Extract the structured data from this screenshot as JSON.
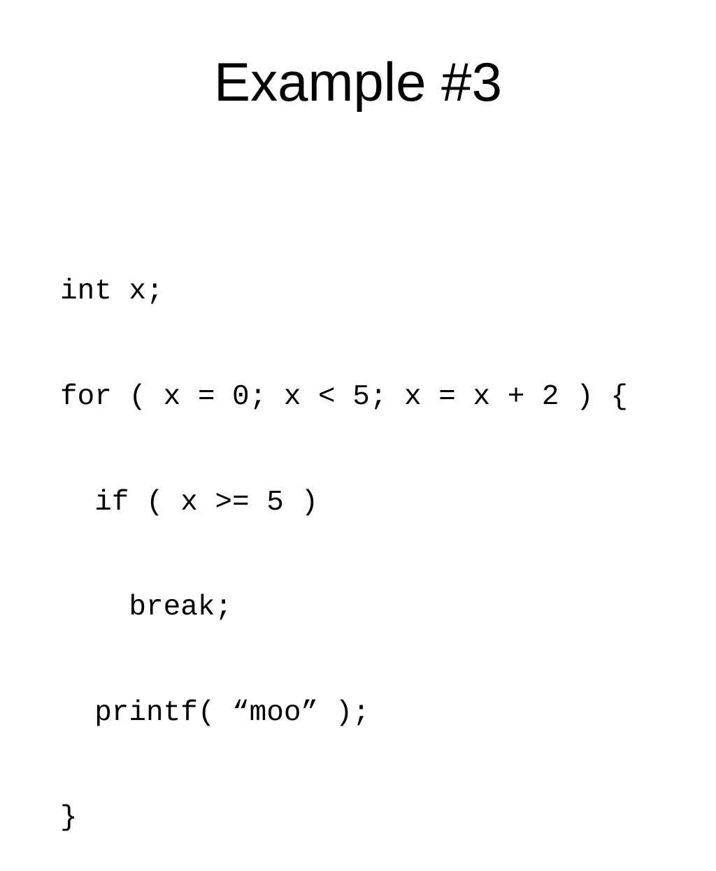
{
  "slide": {
    "title": "Example #3",
    "code_lines": [
      "int x;",
      "for ( x = 0; x < 5; x = x + 2 ) {",
      "  if ( x >= 5 )",
      "    break;",
      "  printf( “moo” );",
      "}"
    ]
  }
}
